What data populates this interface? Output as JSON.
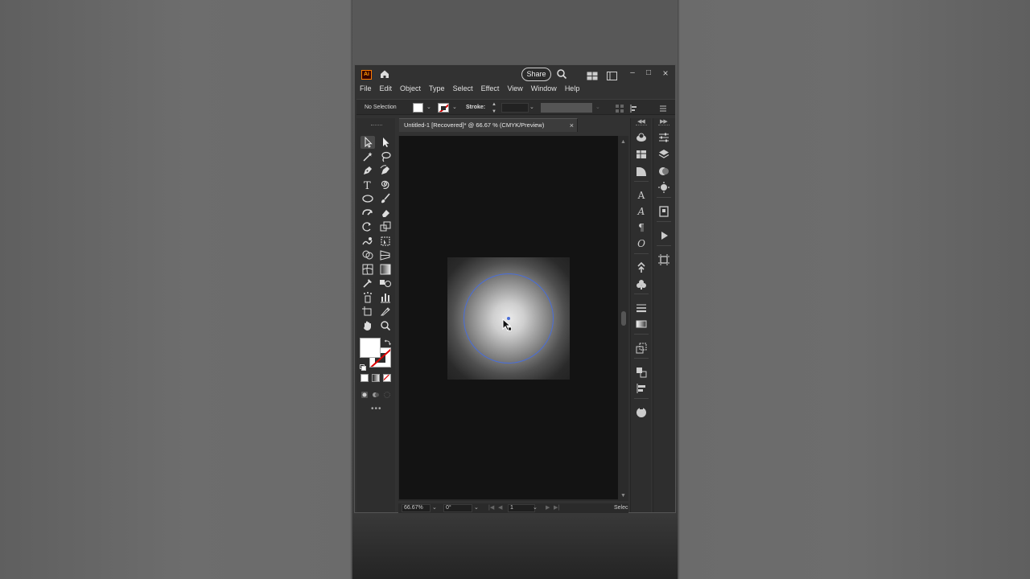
{
  "app": {
    "logo_text": "Ai",
    "share_label": "Share"
  },
  "menu": [
    "File",
    "Edit",
    "Object",
    "Type",
    "Select",
    "Effect",
    "View",
    "Window",
    "Help"
  ],
  "control_bar": {
    "selection_label": "No Selection",
    "stroke_label": "Stroke:"
  },
  "document": {
    "tab_title": "Untitled-1 [Recovered]* @ 66.67 % (CMYK/Preview)",
    "close_glyph": "×"
  },
  "status_bar": {
    "zoom": "66.67%",
    "rotation": "0°",
    "artboard_number": "1",
    "current_tool": "Selec"
  },
  "colors": {
    "accent_selection": "#4a6ed8",
    "logo_border": "#ff7c00",
    "none_stroke": "#dd0000"
  },
  "icons": {
    "tools": [
      "selection-tool",
      "direct-selection-tool",
      "magic-wand-tool",
      "lasso-tool",
      "pen-tool",
      "curvature-tool",
      "type-tool",
      "spiral-tool",
      "ellipse-tool",
      "paintbrush-tool",
      "shaper-tool",
      "eraser-tool",
      "rotate-tool",
      "scale-tool",
      "warp-tool",
      "free-transform-tool",
      "shape-builder-tool",
      "perspective-grid-tool",
      "mesh-tool",
      "gradient-tool",
      "eyedropper-tool",
      "blend-tool",
      "symbol-sprayer-tool",
      "graph-tool",
      "artboard-tool",
      "slice-tool",
      "hand-tool",
      "zoom-tool"
    ]
  }
}
